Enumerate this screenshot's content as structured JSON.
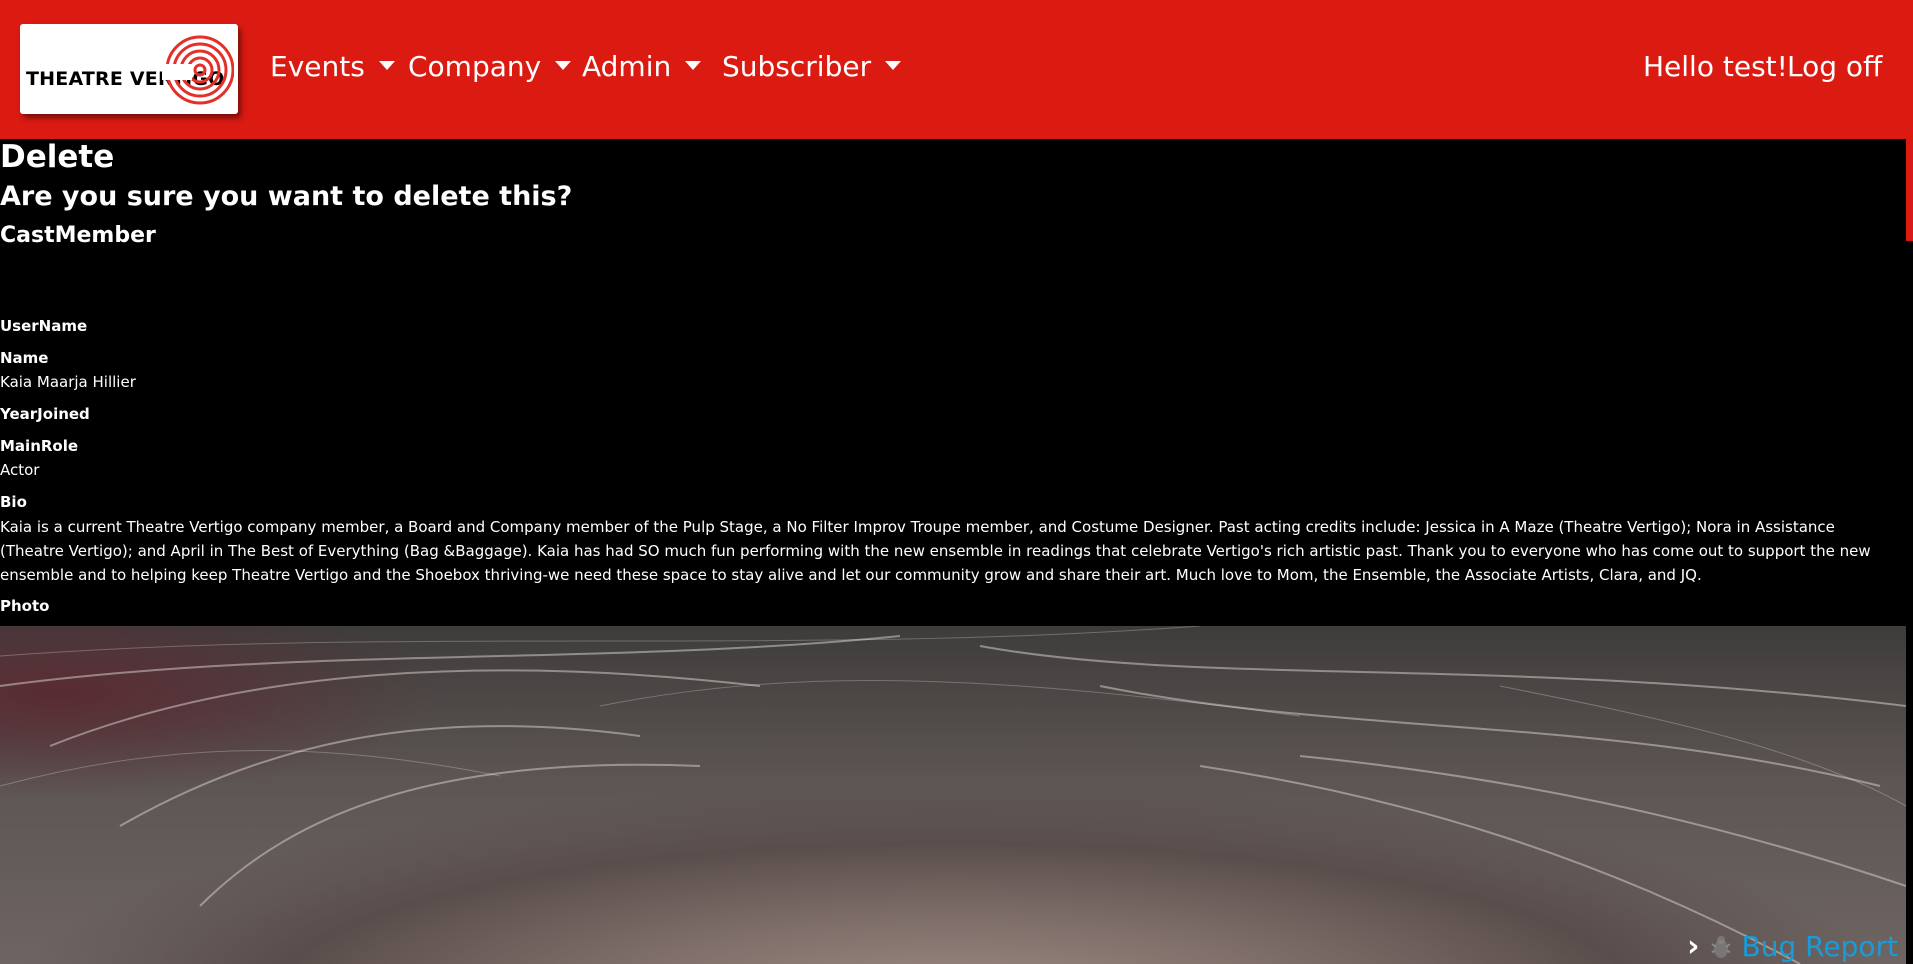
{
  "brand": {
    "name": "THEATRE VERTIGO",
    "accent": "#db1a12"
  },
  "nav": {
    "items": [
      {
        "label": "Events"
      },
      {
        "label": "Company"
      },
      {
        "label": "Admin"
      },
      {
        "label": "Subscriber"
      }
    ],
    "greeting": "Hello test!",
    "logoff": "Log off"
  },
  "page": {
    "title": "Delete",
    "confirm": "Are you sure you want to delete this?",
    "entity": "CastMember"
  },
  "fields": {
    "username": {
      "label": "UserName",
      "value": ""
    },
    "name": {
      "label": "Name",
      "value": "Kaia Maarja Hillier"
    },
    "year_joined": {
      "label": "YearJoined",
      "value": ""
    },
    "main_role": {
      "label": "MainRole",
      "value": "Actor"
    },
    "bio": {
      "label": "Bio",
      "value": "Kaia is a current Theatre Vertigo company member, a Board and Company member of the Pulp Stage, a No Filter Improv Troupe member, and Costume Designer. Past acting credits include: Jessica in A Maze (Theatre Vertigo); Nora in Assistance (Theatre Vertigo); and April in The Best of Everything (Bag &Baggage). Kaia has had SO much fun performing with the new ensemble in readings that celebrate Vertigo's rich artistic past. Thank you to everyone who has come out to support the new ensemble and to helping keep Theatre Vertigo and the Shoebox thriving-we need these space to stay alive and let our community grow and share their art. Much love to Mom, the Ensemble, the Associate Artists, Clara, and JQ."
    },
    "photo": {
      "label": "Photo"
    }
  },
  "footer": {
    "bug_report": "Bug Report",
    "bug_color": "#1a9bd7"
  }
}
